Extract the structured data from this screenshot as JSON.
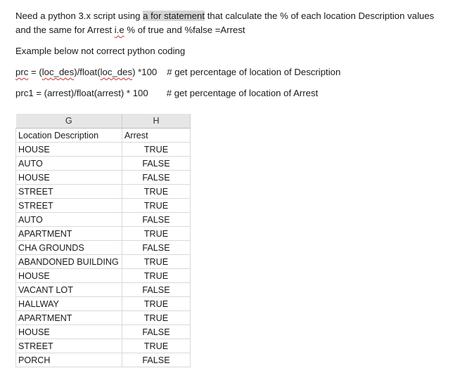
{
  "question": {
    "line1_before": "Need a python 3.x script using ",
    "line1_highlight": "a for statement",
    "line1_after": " that calculate the % of each location Description values",
    "line2_before": "and the same for Arrest ",
    "line2_squiggle": "i.e",
    "line2_after": " % of true and %false =Arrest",
    "example_intro": "Example below not correct python coding",
    "code1": {
      "var": "prc",
      "eq": " = (",
      "arg1": "loc_des",
      "mid": ")/float(",
      "arg2": "loc_des",
      "tail": ") *100",
      "comment": "# get percentage of location of Description"
    },
    "code2": {
      "text": "prc1 = (arrest)/float(arrest) * 100",
      "comment": "# get percentage of location of Arrest"
    }
  },
  "sheet": {
    "col_headers": [
      "G",
      "H"
    ],
    "field_headers": [
      "Location Description",
      "Arrest"
    ],
    "rows": [
      {
        "location": "HOUSE",
        "arrest": "TRUE"
      },
      {
        "location": "AUTO",
        "arrest": "FALSE"
      },
      {
        "location": "HOUSE",
        "arrest": "FALSE"
      },
      {
        "location": "STREET",
        "arrest": "TRUE"
      },
      {
        "location": "STREET",
        "arrest": "TRUE"
      },
      {
        "location": "AUTO",
        "arrest": "FALSE"
      },
      {
        "location": "APARTMENT",
        "arrest": "TRUE"
      },
      {
        "location": "CHA GROUNDS",
        "arrest": "FALSE"
      },
      {
        "location": "ABANDONED BUILDING",
        "arrest": "TRUE"
      },
      {
        "location": "HOUSE",
        "arrest": "TRUE"
      },
      {
        "location": "VACANT LOT",
        "arrest": "FALSE"
      },
      {
        "location": "HALLWAY",
        "arrest": "TRUE"
      },
      {
        "location": "APARTMENT",
        "arrest": "TRUE"
      },
      {
        "location": "HOUSE",
        "arrest": "FALSE"
      },
      {
        "location": "STREET",
        "arrest": "TRUE"
      },
      {
        "location": "PORCH",
        "arrest": "FALSE"
      }
    ]
  }
}
